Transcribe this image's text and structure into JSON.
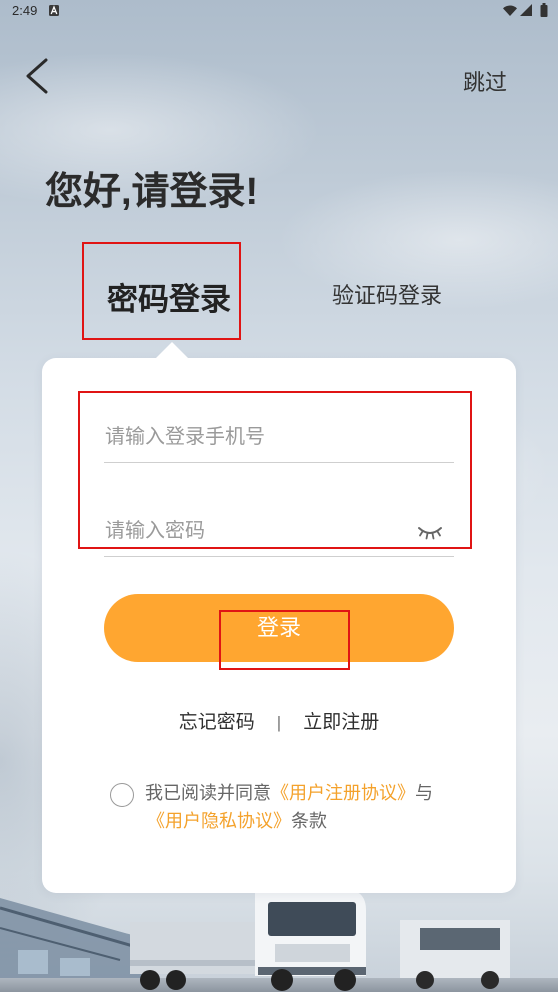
{
  "status_bar": {
    "time": "2:49",
    "icons": [
      "a-notification-icon",
      "wifi-icon",
      "signal-icon",
      "battery-icon"
    ]
  },
  "header": {
    "back_icon": "chevron-left-icon",
    "skip_label": "跳过"
  },
  "greeting": "您好,请登录!",
  "tabs": [
    {
      "label": "密码登录",
      "active": true
    },
    {
      "label": "验证码登录",
      "active": false
    }
  ],
  "form": {
    "phone": {
      "value": "",
      "placeholder": "请输入登录手机号"
    },
    "password": {
      "value": "",
      "placeholder": "请输入密码",
      "visibility_icon": "eye-closed-icon"
    },
    "submit_label": "登录"
  },
  "links": {
    "forgot_password": "忘记密码",
    "separator": "|",
    "register": "立即注册"
  },
  "agreement": {
    "checked": false,
    "prefix": "我已阅读并同意",
    "terms_link": "《用户注册协议》",
    "conjunction": "与",
    "privacy_link": "《用户隐私协议》",
    "suffix": "条款"
  },
  "colors": {
    "accent": "#FFA630",
    "link": "#F4A22C",
    "annotation": "#E01414",
    "text": "#2B2B2B",
    "placeholder": "#9A9A9A"
  }
}
